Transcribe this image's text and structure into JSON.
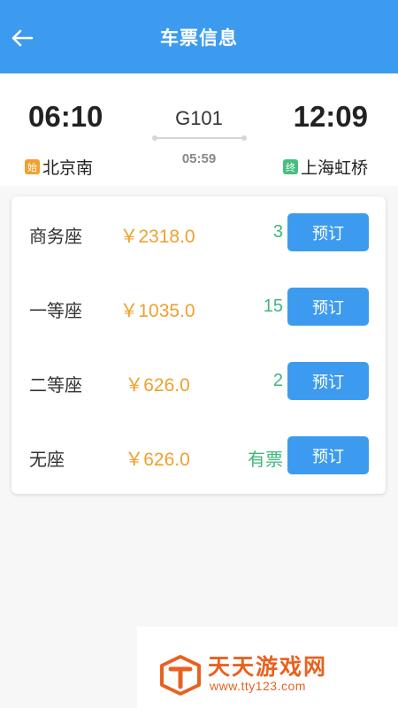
{
  "header": {
    "title": "车票信息",
    "back_icon": "arrow-left-icon"
  },
  "train": {
    "number": "G101",
    "departure_time": "06:10",
    "arrival_time": "12:09",
    "duration": "05:59",
    "from_badge": "始",
    "from_station": "北京南",
    "to_badge": "终",
    "to_station": "上海虹桥"
  },
  "seats": [
    {
      "name": "商务座",
      "price": "￥2318.0",
      "count": "3",
      "button": "预订"
    },
    {
      "name": "一等座",
      "price": "￥1035.0",
      "count": "15",
      "button": "预订"
    },
    {
      "name": "二等座",
      "price": "￥626.0",
      "count": "2",
      "button": "预订"
    },
    {
      "name": "无座",
      "price": "￥626.0",
      "count": "有票",
      "button": "预订"
    }
  ],
  "watermark": {
    "title": "天天游戏网",
    "url": "www.tty123.com"
  },
  "colors": {
    "primary": "#3d9bef",
    "price": "#f0a02e",
    "count": "#3db87a",
    "start_badge": "#f0a02e",
    "end_badge": "#46bf7e"
  }
}
